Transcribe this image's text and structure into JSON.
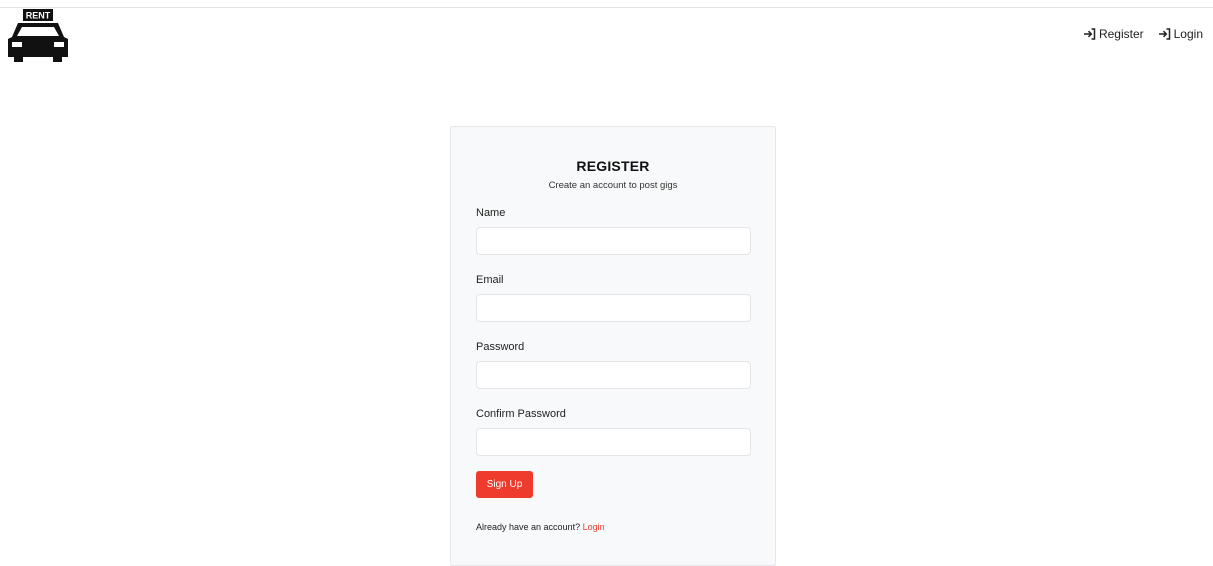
{
  "header": {
    "logo_text": "RENT",
    "nav": [
      {
        "label": "Register",
        "icon": "sign-in-icon"
      },
      {
        "label": "Login",
        "icon": "sign-in-icon"
      }
    ]
  },
  "form": {
    "title": "REGISTER",
    "subtitle": "Create an account to post gigs",
    "fields": [
      {
        "label": "Name",
        "value": "",
        "placeholder": ""
      },
      {
        "label": "Email",
        "value": "",
        "placeholder": ""
      },
      {
        "label": "Password",
        "value": "",
        "placeholder": ""
      },
      {
        "label": "Confirm Password",
        "value": "",
        "placeholder": ""
      }
    ],
    "submit_label": "Sign Up",
    "footer_text": "Already have an account?",
    "footer_link": "Login"
  },
  "colors": {
    "accent": "#ef3b2d",
    "card_bg": "#f8f9fa"
  }
}
